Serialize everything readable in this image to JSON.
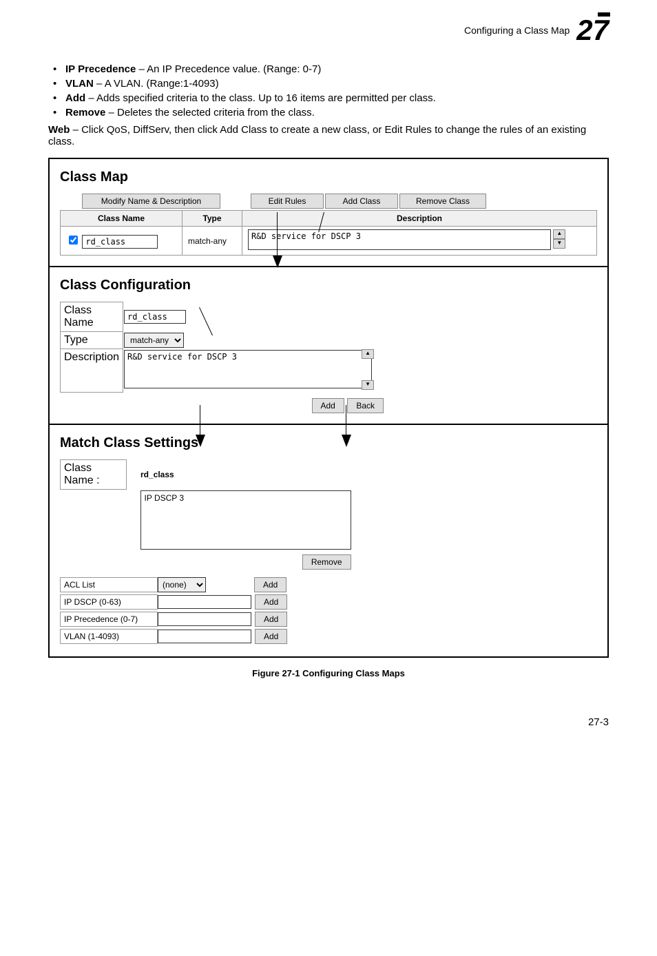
{
  "header": {
    "breadcrumb": "Configuring a Class Map",
    "chapter": "27"
  },
  "bullets": [
    {
      "term": "IP Precedence",
      "desc": " – An IP Precedence value. (Range: 0-7)"
    },
    {
      "term": "VLAN",
      "desc": " – A VLAN. (Range:1-4093)"
    },
    {
      "term": "Add",
      "desc": " – Adds specified criteria to the class. Up to 16 items are permitted per class."
    },
    {
      "term": "Remove",
      "desc": " – Deletes the selected criteria from the class."
    }
  ],
  "web_text": {
    "prefix": "Web",
    "body": " – Click QoS, DiffServ, then click Add Class to create a new class, or Edit Rules to change the rules of an existing class."
  },
  "class_map": {
    "title": "Class Map",
    "buttons": {
      "modify": "Modify Name & Description",
      "edit_rules": "Edit Rules",
      "add_class": "Add Class",
      "remove_class": "Remove Class"
    },
    "headers": {
      "class_name": "Class Name",
      "type": "Type",
      "description": "Description"
    },
    "row": {
      "name": "rd_class",
      "type": "match-any",
      "desc": "R&D service for DSCP 3"
    }
  },
  "class_config": {
    "title": "Class Configuration",
    "labels": {
      "class_name": "Class Name",
      "type": "Type",
      "description": "Description"
    },
    "values": {
      "class_name": "rd_class",
      "type": "match-any",
      "description": "R&D service for DSCP 3"
    },
    "buttons": {
      "add": "Add",
      "back": "Back"
    }
  },
  "match": {
    "title": "Match Class Settings",
    "class_name_label": "Class Name :",
    "class_name_value": "rd_class",
    "list_item": "IP DSCP 3",
    "remove": "Remove",
    "rows": {
      "acl_list": "ACL List",
      "acl_value": "(none)",
      "ip_dscp": "IP DSCP (0-63)",
      "ip_prec": "IP Precedence (0-7)",
      "vlan": "VLAN (1-4093)",
      "add": "Add"
    }
  },
  "figure_caption": "Figure 27-1  Configuring Class Maps",
  "page_number": "27-3"
}
